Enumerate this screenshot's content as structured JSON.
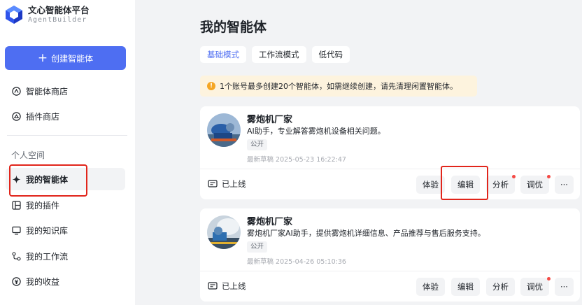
{
  "app": {
    "title": "文心智能体平台",
    "subtitle": "AgentBuilder"
  },
  "sidebar": {
    "create_label": "创建智能体",
    "items": [
      {
        "label": "智能体商店",
        "icon": "store-icon"
      },
      {
        "label": "插件商店",
        "icon": "plugin-store-icon"
      }
    ],
    "section_label": "个人空间",
    "personal": [
      {
        "label": "我的智能体",
        "icon": "sparkle-icon"
      },
      {
        "label": "我的插件",
        "icon": "plugin-icon"
      },
      {
        "label": "我的知识库",
        "icon": "monitor-icon"
      },
      {
        "label": "我的工作流",
        "icon": "workflow-icon"
      },
      {
        "label": "我的收益",
        "icon": "income-icon"
      }
    ]
  },
  "main": {
    "title": "我的智能体",
    "tabs": [
      {
        "label": "基础模式",
        "active": true
      },
      {
        "label": "工作流模式",
        "active": false
      },
      {
        "label": "低代码",
        "active": false
      }
    ],
    "notice": "1个账号最多创建20个智能体，如需继续创建，请先清理闲置智能体。",
    "agents": [
      {
        "name": "雾炮机厂家",
        "description": "AI助手，专业解答雾炮机设备相关问题。",
        "badge": "公开",
        "draft": "最新草稿 2025-05-23 16:22:47",
        "status": "已上线",
        "actions": {
          "try": "体验",
          "edit": "编辑",
          "analyze": "分析",
          "tune": "调优",
          "more": "···"
        }
      },
      {
        "name": "雾炮机厂家",
        "description": "雾炮机厂家AI助手，提供雾炮机详细信息、产品推荐与售后服务支持。",
        "badge": "公开",
        "draft": "最新草稿 2025-04-26 05:10:36",
        "status": "已上线",
        "actions": {
          "try": "体验",
          "edit": "编辑",
          "analyze": "分析",
          "tune": "调优",
          "more": "···"
        }
      }
    ]
  },
  "colors": {
    "accent": "#4e6ef2",
    "highlight": "#e1251b",
    "notice_bg": "#fdf3de",
    "notice_icon": "#f5a623",
    "red_dot": "#f54a45"
  }
}
